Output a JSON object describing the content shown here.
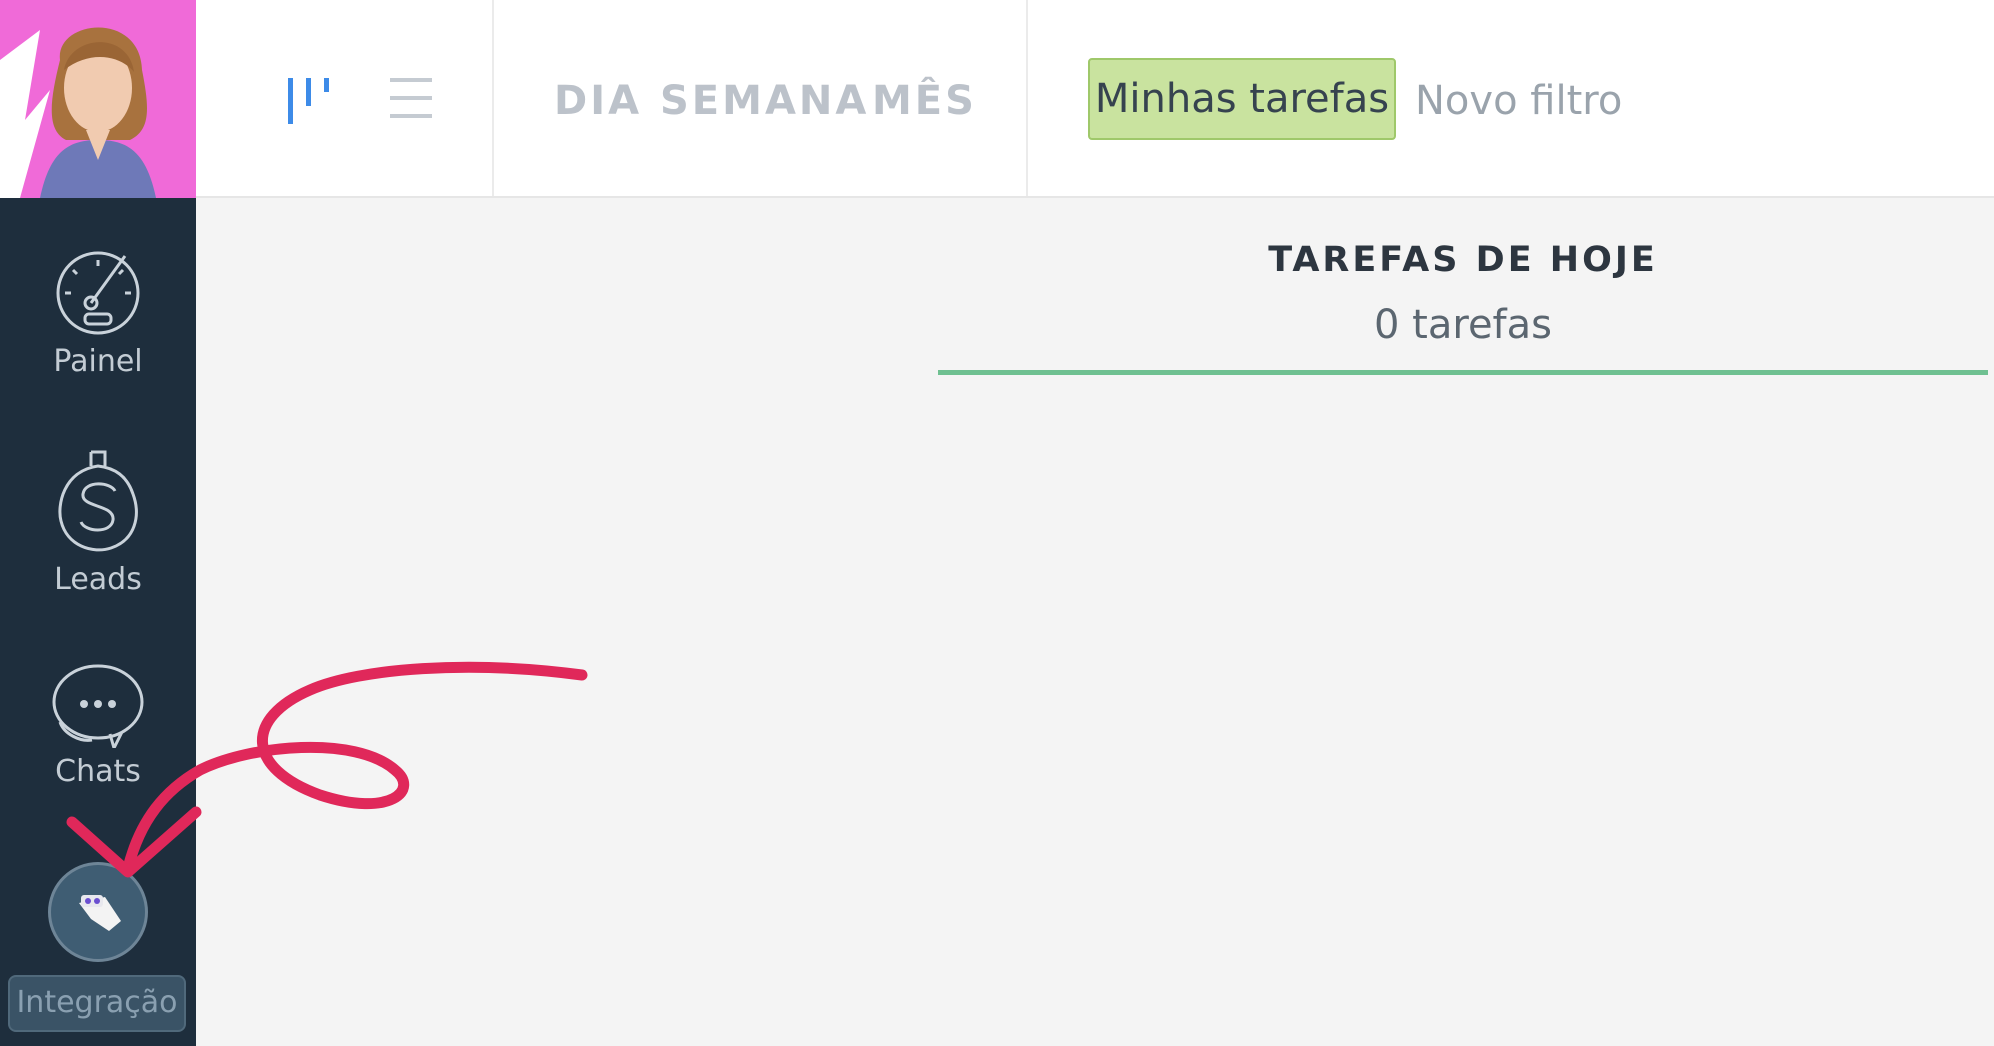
{
  "sidebar": {
    "items": [
      {
        "label": "Painel",
        "icon": "speedometer-icon"
      },
      {
        "label": "Leads",
        "icon": "dollar-icon"
      },
      {
        "label": "Chats",
        "icon": "chat-bubble-icon"
      }
    ],
    "integration": {
      "label": "Integração",
      "icon": "plugin-icon"
    }
  },
  "topbar": {
    "view_icons": [
      "pipeline-view-icon",
      "list-view-icon"
    ],
    "periods": [
      "DIA",
      "SEMANA",
      "MÊS"
    ],
    "filter_active": "Minhas tarefas",
    "filter_new": "Novo filtro"
  },
  "main": {
    "column_title": "TAREFAS DE HOJE",
    "column_count": "0 tarefas"
  },
  "colors": {
    "sidebar_bg": "#1e2e3d",
    "active_filter_bg": "#c9e39f",
    "column_line": "#6fc091",
    "annotation": "#e0285a"
  }
}
